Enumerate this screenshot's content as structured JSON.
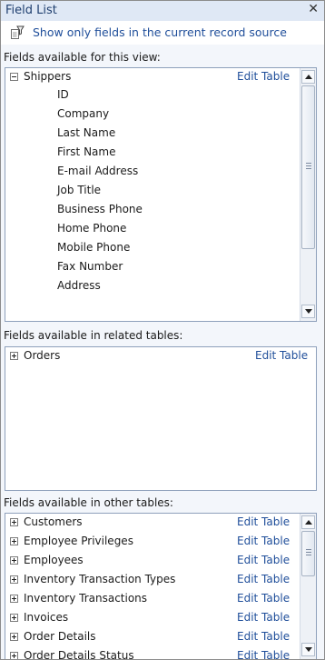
{
  "panel": {
    "title": "Field List",
    "close_glyph": "✕"
  },
  "show_only": {
    "label": "Show only fields in the current record source",
    "icon": "filter-document-icon"
  },
  "this_view": {
    "label": "Fields available for this view:",
    "table": "Shippers",
    "edit_label": "Edit Table",
    "fields": [
      "ID",
      "Company",
      "Last Name",
      "First Name",
      "E-mail Address",
      "Job Title",
      "Business Phone",
      "Home Phone",
      "Mobile Phone",
      "Fax Number",
      "Address"
    ]
  },
  "related": {
    "label": "Fields available in related tables:",
    "table": "Orders",
    "edit_label": "Edit Table"
  },
  "other": {
    "label": "Fields available in other tables:",
    "edit_label": "Edit Table",
    "tables": [
      "Customers",
      "Employee Privileges",
      "Employees",
      "Inventory Transaction Types",
      "Inventory Transactions",
      "Invoices",
      "Order Details",
      "Order Details Status"
    ]
  },
  "colors": {
    "link": "#1f4e9a",
    "title_bar": "#dfe8f5",
    "panel_bg": "#f3f6fb"
  }
}
